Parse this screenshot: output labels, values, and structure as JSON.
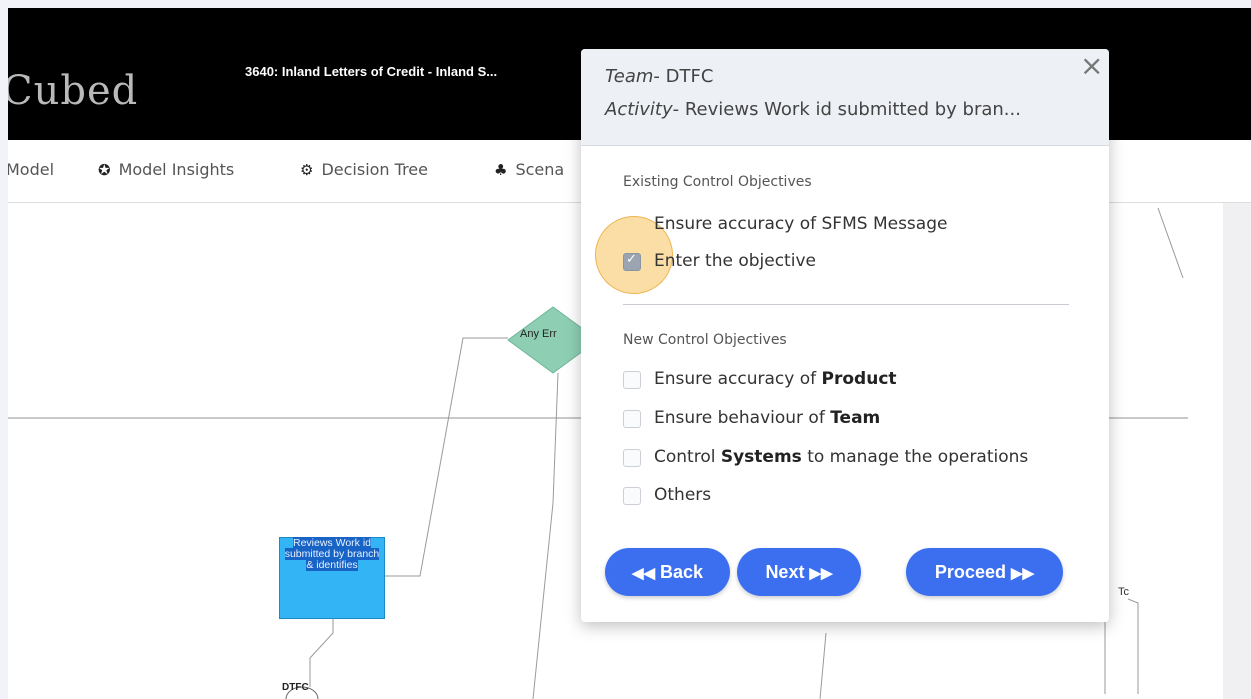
{
  "app": {
    "brand": "Cubed",
    "title": "3640: Inland Letters of Credit - Inland S..."
  },
  "nav": {
    "items": [
      {
        "label": "Model",
        "icon": ""
      },
      {
        "label": "Model Insights",
        "icon": "insights-icon"
      },
      {
        "label": "Decision Tree",
        "icon": "gears-icon"
      },
      {
        "label": "Scena",
        "icon": "hierarchy-icon"
      }
    ]
  },
  "canvas": {
    "task_label": "Reviews Work id submitted by branch & identifies",
    "decision_label": "Any Err",
    "start_node_label": "DTFC",
    "right_node_label": "Tc"
  },
  "popup": {
    "team_key": "Team",
    "team_value": "- DTFC",
    "activity_key": "Activity",
    "activity_value": "- Reviews Work id submitted by bran...",
    "close_symbol": "×",
    "existing_title": "Existing Control Objectives",
    "existing": [
      {
        "text": "Ensure accuracy of SFMS Message",
        "checked": false
      },
      {
        "text": "Enter the objective",
        "checked": true
      }
    ],
    "new_title": "New Control Objectives",
    "new_items": [
      {
        "prefix": "Ensure accuracy of ",
        "bold": "Product",
        "suffix": "",
        "checked": false
      },
      {
        "prefix": "Ensure behaviour of ",
        "bold": "Team",
        "suffix": "",
        "checked": false
      },
      {
        "prefix": "Control ",
        "bold": "Systems",
        "suffix": " to manage the operations",
        "checked": false
      },
      {
        "prefix": "Others",
        "bold": "",
        "suffix": "",
        "checked": false
      }
    ],
    "buttons": {
      "back": "Back",
      "back_icon": "◀◀",
      "next": "Next",
      "next_icon": "▶▶",
      "proceed": "Proceed",
      "proceed_icon": "▶▶"
    }
  },
  "colors": {
    "topbar": "#000000",
    "primary_button": "#3b6ff0",
    "task_fill": "#33b5f5",
    "decision_fill": "#8ecfb4",
    "highlight": "#f7c35c"
  }
}
